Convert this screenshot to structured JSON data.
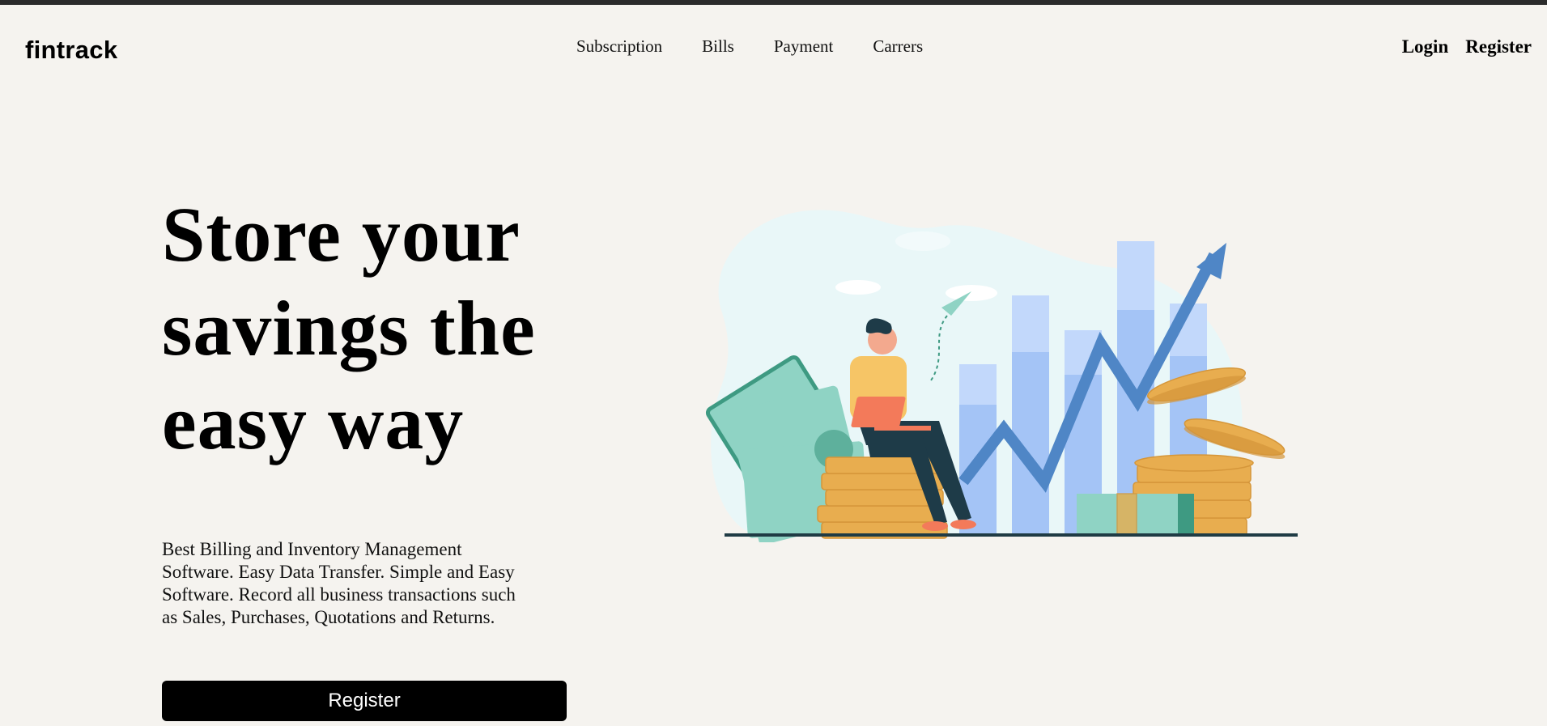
{
  "brand": {
    "name": "fintrack"
  },
  "nav": {
    "items": [
      {
        "label": "Subscription"
      },
      {
        "label": "Bills"
      },
      {
        "label": "Payment"
      },
      {
        "label": "Carrers"
      }
    ]
  },
  "auth": {
    "login_label": "Login",
    "register_label": "Register"
  },
  "hero": {
    "title_lines": [
      "Store your",
      "savings the",
      "easy way"
    ],
    "description_lines": [
      "Best Billing and Inventory Management",
      "Software. Easy Data Transfer. Simple and Easy",
      "Software. Record all business transactions such",
      "as Sales, Purchases, Quotations and Returns."
    ],
    "cta_label": "Register"
  },
  "illustration": {
    "icon": "savings-growth-illustration",
    "colors": {
      "blob": "#e9f7f8",
      "bar_light": "#c2d8fb",
      "bar": "#a4c4f6",
      "arrow": "#4f86c6",
      "coin": "#e8ad4f",
      "coin_dark": "#d5963a",
      "money": "#8fd3c4",
      "money_dark": "#3e9a82",
      "shirt": "#f6c566",
      "pants": "#1e3b48",
      "laptop": "#f37a5a",
      "skin": "#f3a98e",
      "ground": "#1f3b44"
    }
  }
}
